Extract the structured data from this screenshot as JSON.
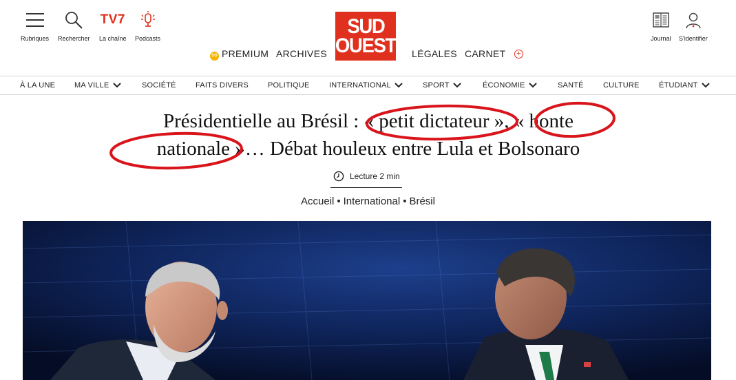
{
  "header": {
    "tools": [
      {
        "label": "Rubriques",
        "icon": "menu-icon"
      },
      {
        "label": "Rechercher",
        "icon": "search-icon"
      },
      {
        "label": "La chaîne",
        "brand": "TV7"
      },
      {
        "label": "Podcasts",
        "icon": "microphone-icon"
      }
    ],
    "logo": {
      "line1": "SUD",
      "line2": "OUEST",
      "color": "#e0301e"
    },
    "links_left": {
      "premium_badge": "SO",
      "premium": "PREMIUM",
      "archives": "ARCHIVES"
    },
    "links_right": {
      "legales": "LÉGALES",
      "carnet": "CARNET",
      "more": "+"
    },
    "user_tools": [
      {
        "label": "Journal",
        "icon": "newspaper-icon"
      },
      {
        "label": "S'identifier",
        "icon": "user-icon"
      }
    ]
  },
  "nav": [
    {
      "label": "À LA UNE",
      "dropdown": false
    },
    {
      "label": "MA VILLE",
      "dropdown": true
    },
    {
      "label": "SOCIÉTÉ",
      "dropdown": false
    },
    {
      "label": "FAITS DIVERS",
      "dropdown": false
    },
    {
      "label": "POLITIQUE",
      "dropdown": false
    },
    {
      "label": "INTERNATIONAL",
      "dropdown": true
    },
    {
      "label": "SPORT",
      "dropdown": true
    },
    {
      "label": "ÉCONOMIE",
      "dropdown": true
    },
    {
      "label": "SANTÉ",
      "dropdown": false
    },
    {
      "label": "CULTURE",
      "dropdown": false
    },
    {
      "label": "ÉTUDIANT",
      "dropdown": true
    }
  ],
  "article": {
    "title_line1": "Présidentielle au Brésil : « petit dictateur », « honte",
    "title_line2": "nationale »… Débat houleux entre Lula et Bolsonaro",
    "reading_time": "Lecture 2 min",
    "breadcrumb": {
      "home": "Accueil",
      "section": "International",
      "subsection": "Brésil",
      "separator": "•"
    }
  },
  "annotation_color": "#d9141b",
  "accent_color": "#e0301e"
}
